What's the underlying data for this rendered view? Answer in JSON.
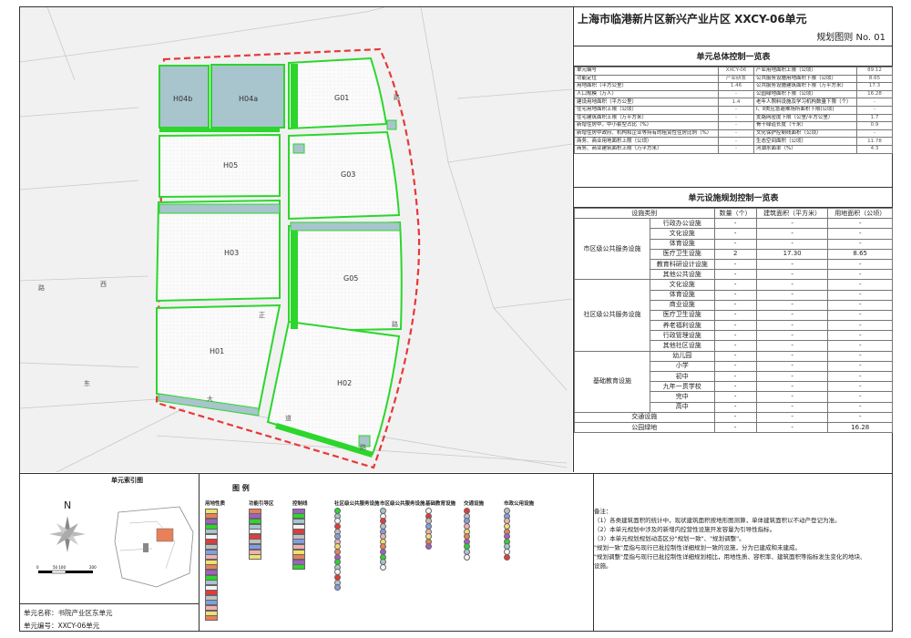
{
  "title": "上海市临港新片区新兴产业片区 XXCY-06单元",
  "subtitle": "规划图则 No. 01",
  "control_table": {
    "header": "单元总体控制一览表",
    "rows": [
      [
        "单元编号",
        "XXCY-06",
        "产业用地面积上限（公顷）",
        "89.12"
      ],
      [
        "功能定位",
        "产业研发",
        "公共服务设施用地面积下限（公顷）",
        "8.65"
      ],
      [
        "用地面积（平方公里）",
        "1.46",
        "公共服务设施建筑面积下限（万平方米）",
        "17.3"
      ],
      [
        "人口规模（万人）",
        "-",
        "公园绿地面积下限（公顷）",
        "16.28"
      ],
      [
        "建设用地面积（平方公里）",
        "1.4",
        "老年人照料设施及学习机构数量下限（个）",
        "-"
      ],
      [
        "住宅用地面积上限（公顷）",
        "-",
        "Ⅰ、Ⅱ类应急避难场所面积下限(公顷)",
        "-"
      ],
      [
        "住宅建筑面积上限（万平方米）",
        "-",
        "支路网密度下限（公里/平方公里）",
        "1.7"
      ],
      [
        "新增住房中，中小套型占比（%）",
        "-",
        "骨干绿道长度（千米）",
        "0.9"
      ],
      [
        "新增住房中政府、机构和企业等持有的租赁性住房比例（%）",
        "-",
        "文化保护控制线面积（公顷）",
        "-"
      ],
      [
        "商务、商业用地面积上限（公顷）",
        "-",
        "生态空间面积（公顷）",
        "11.78"
      ],
      [
        "商务、商业建筑面积上限（万平方米）",
        "-",
        "河湖水面率（%）",
        "4.3"
      ]
    ]
  },
  "facility_table": {
    "header": "单元设施规划控制一览表",
    "columns": [
      "设施类别",
      "数量（个）",
      "建筑面积（平方米）",
      "用地面积（公顷）"
    ],
    "groups": [
      {
        "name": "市区级公共服务设施",
        "items": [
          [
            "行政办公设施",
            "-",
            "-",
            "-"
          ],
          [
            "文化设施",
            "-",
            "-",
            "-"
          ],
          [
            "体育设施",
            "-",
            "-",
            "-"
          ],
          [
            "医疗卫生设施",
            "2",
            "17.30",
            "8.65"
          ],
          [
            "教育科研设计设施",
            "-",
            "-",
            "-"
          ],
          [
            "其他公共设施",
            "-",
            "-",
            "-"
          ]
        ]
      },
      {
        "name": "社区级公共服务设施",
        "items": [
          [
            "文化设施",
            "-",
            "-",
            "-"
          ],
          [
            "体育设施",
            "-",
            "-",
            "-"
          ],
          [
            "商业设施",
            "-",
            "-",
            "-"
          ],
          [
            "医疗卫生设施",
            "-",
            "-",
            "-"
          ],
          [
            "养老福利设施",
            "-",
            "-",
            "-"
          ],
          [
            "行政管理设施",
            "-",
            "-",
            "-"
          ],
          [
            "其他社区设施",
            "-",
            "-",
            "-"
          ]
        ]
      },
      {
        "name": "基础教育设施",
        "items": [
          [
            "幼儿园",
            "-",
            "-",
            "-"
          ],
          [
            "小学",
            "-",
            "-",
            "-"
          ],
          [
            "初中",
            "-",
            "-",
            "-"
          ],
          [
            "九年一贯学校",
            "-",
            "-",
            "-"
          ],
          [
            "完中",
            "-",
            "-",
            "-"
          ],
          [
            "高中",
            "-",
            "-",
            "-"
          ]
        ]
      }
    ],
    "tail": [
      [
        "交通设施",
        "-",
        "-",
        "-"
      ],
      [
        "公园绿地",
        "-",
        "-",
        "16.28"
      ]
    ]
  },
  "map": {
    "parcels": [
      "H04b",
      "H04a",
      "G01",
      "H05",
      "G03",
      "H03",
      "G05",
      "H01",
      "H02"
    ],
    "road_chars": [
      "东",
      "西",
      "大",
      "道",
      "路",
      "路",
      "正",
      "路",
      "路",
      "路"
    ]
  },
  "index_map": {
    "header": "单元索引图",
    "north": "N",
    "scale": [
      "0",
      "50 100",
      "200"
    ],
    "unit_name": "单元名称：书院产业区东单元",
    "unit_code": "单元编号：XXCY-06单元"
  },
  "legend": {
    "header": "图  例",
    "columns": [
      "用地性质",
      "功能引导区",
      "控制线",
      "社区级公共服务设施",
      "市区级公共服务设施",
      "基础教育设施",
      "交通设施",
      "市政公用设施"
    ],
    "colors": {
      "green": "#2cd62c",
      "blue": "#a8c4cc",
      "hatch": "#f4f4f4",
      "red": "#e8383a",
      "orange": "#e8805a",
      "yellow": "#f0e070",
      "purple": "#a060c0"
    }
  },
  "notes": {
    "title": "备注：",
    "lines": [
      "（1）各类建筑面积的统计中，现状建筑面积按地形图测算，单体建筑面积以不动产登记为准。",
      "（2）本单元规划中涉及的新增内控营性设施开发容量为引导性指标。",
      "（3）本单元规划规划动态区分\"规划一致\"、\"规划调整\"。",
      "\"规划一致\"是指与现行已批控制性详细规划一致的设施，分为已建成和未建成。",
      "\"规划调整\"是指与现行已批控制性详细规划相比，用地性质、容积率、建筑面积等指标发生变化的地块、",
      "设施。"
    ]
  }
}
